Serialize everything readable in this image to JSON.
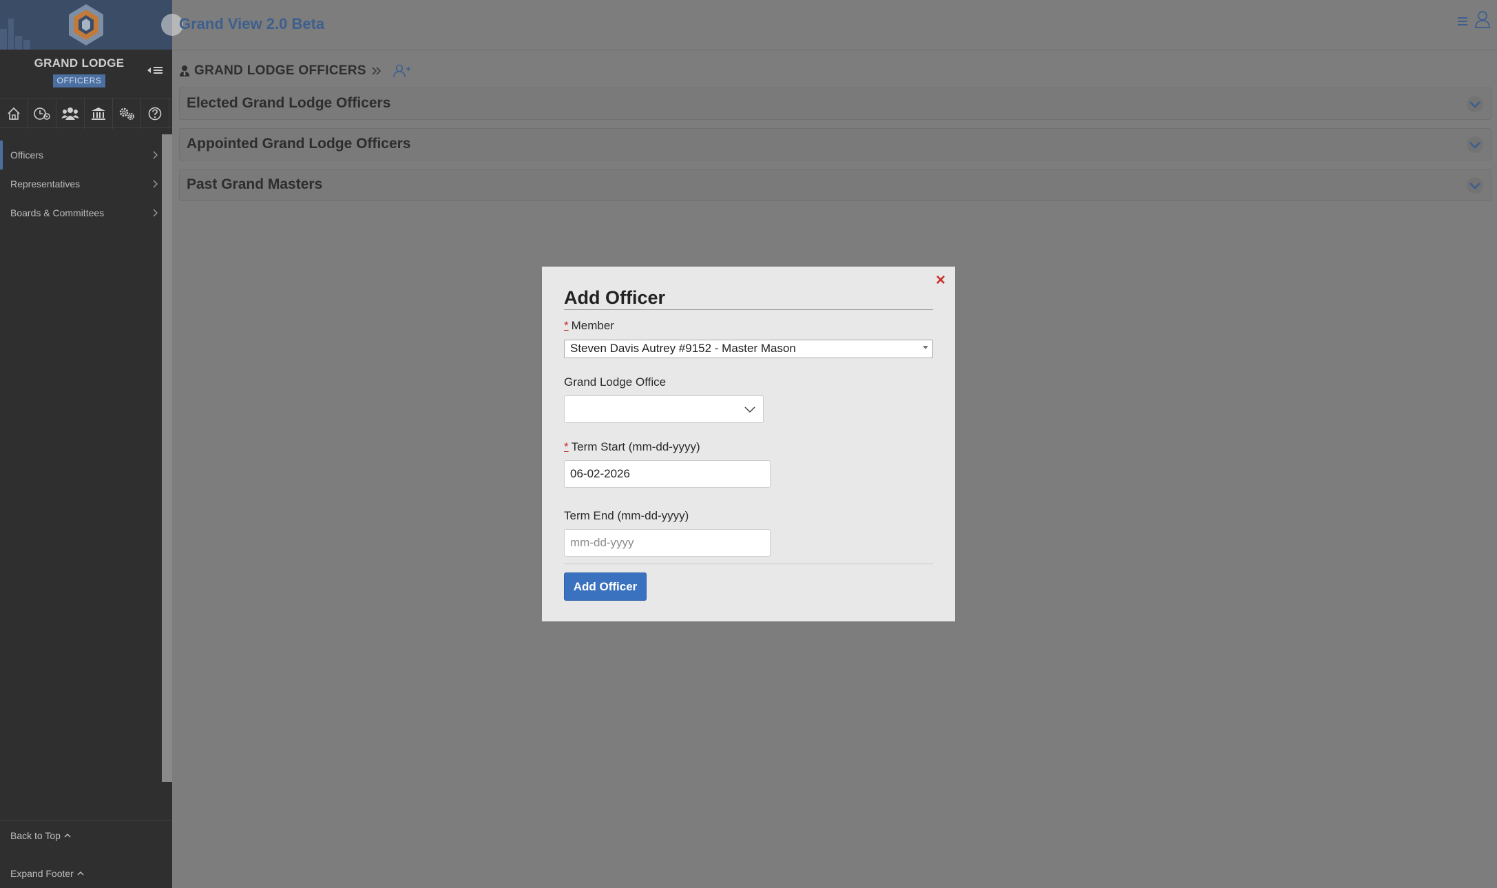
{
  "sidebar": {
    "brand_title": "GRAND LODGE",
    "brand_badge": "OFFICERS",
    "icon_bar": [
      "home-icon",
      "lodge-settings-icon",
      "members-icon",
      "institution-icon",
      "settings-gears-icon",
      "help-icon"
    ],
    "nav_items": [
      {
        "label": "Officers",
        "active": true
      },
      {
        "label": "Representatives",
        "active": false
      },
      {
        "label": "Boards & Committees",
        "active": false
      }
    ],
    "back_to_top": "Back to Top",
    "expand_footer": "Expand Footer"
  },
  "header": {
    "app_title": "Grand View 2.0 Beta"
  },
  "breadcrumb": {
    "label": "GRAND LODGE OFFICERS"
  },
  "panels": [
    {
      "title": "Elected Grand Lodge Officers"
    },
    {
      "title": "Appointed Grand Lodge Officers"
    },
    {
      "title": "Past Grand Masters"
    }
  ],
  "modal": {
    "title": "Add Officer",
    "close_glyph": "×",
    "required_marker": "*",
    "member_label": "Member",
    "member_value": "Steven Davis Autrey #9152 - Master Mason",
    "office_label": "Grand Lodge Office",
    "office_value": "",
    "term_start_label": "Term Start (mm-dd-yyyy)",
    "term_start_value": "06-02-2026",
    "term_end_label": "Term End (mm-dd-yyyy)",
    "term_end_placeholder": "mm-dd-yyyy",
    "submit_label": "Add Officer"
  },
  "colors": {
    "accent": "#3a72c0",
    "brand_title": "#3d5f8e",
    "required": "#c9302c",
    "sidebar_bg": "#2f2f2f",
    "overlay_bg": "#7d7d7d"
  }
}
